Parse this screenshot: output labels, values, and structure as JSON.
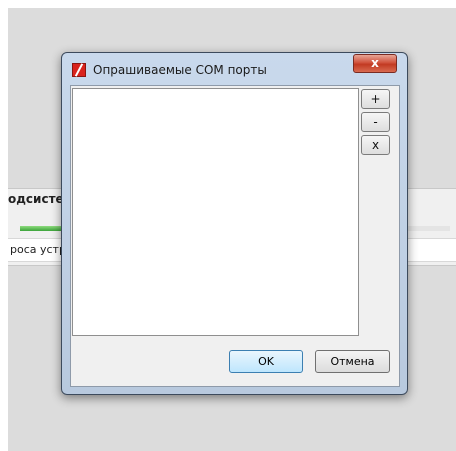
{
  "background_window": {
    "heading": "одсисте",
    "row_text": "роса устр",
    "progress": 0.1
  },
  "dialog": {
    "title": "Опрашиваемые COM порты",
    "close_label": "x",
    "ports": [],
    "side_buttons": {
      "add": "+",
      "remove": "-",
      "clear": "x"
    },
    "ok_label": "OK",
    "cancel_label": "Отмена"
  },
  "colors": {
    "accent": "#3c7fb1",
    "close_button": "#c23a22",
    "progress_fill": "#3ca33a",
    "app_icon": "#d9231d"
  },
  "icons": [
    "app-icon",
    "close-icon"
  ]
}
